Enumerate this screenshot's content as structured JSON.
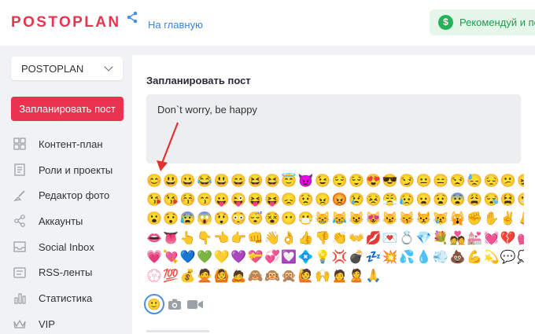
{
  "header": {
    "logo_text": "POSTOPLAN",
    "logo_icon": "share-icon",
    "home_link": "На главную",
    "recommend_label": "Рекомендуй и по",
    "recommend_icon": "dollar-icon",
    "brand_color": "#e8344e",
    "accent_green": "#24b158"
  },
  "sidebar": {
    "project_name": "POSTOPLAN",
    "plan_button": "Запланировать пост",
    "items": [
      {
        "label": "Контент-план",
        "icon": "calendar-grid-icon"
      },
      {
        "label": "Роли и проекты",
        "icon": "document-icon"
      },
      {
        "label": "Редактор фото",
        "icon": "brush-icon"
      },
      {
        "label": "Аккаунты",
        "icon": "share-icon"
      },
      {
        "label": "Social Inbox",
        "icon": "inbox-icon"
      },
      {
        "label": "RSS-ленты",
        "icon": "rss-icon"
      },
      {
        "label": "Статистика",
        "icon": "bar-chart-icon"
      },
      {
        "label": "VIP",
        "icon": "crown-icon"
      }
    ]
  },
  "composer": {
    "title": "Запланировать пост",
    "post_text": "Don`t worry, be happy",
    "emoji_rows": [
      "😊😃😀😂😃😄😆😆😇😈😉😌😌😍😎😏😐😑😒😓😔😕😖",
      "😘😘😚😙😛😜😝😝😞😟😠😡😢😣😤😥😦😧😨😩😪😫😬",
      "😮😯😰😱😲😳😴😵😶😷😸😹😺😻😼😽😾😿🙀✊✋✌👃",
      "👄👅👆👇👈👉👊👋👌👍👎👏👐💋💌💍💎💐💑💒💓💔💕💖",
      "💗💘💙💚💛💜💝💞💟💠💡💢💣💤💥💦💧💨💩💪💫💬💭",
      "💮💯💰🙅🙆🙇🙈🙉🙊🙋🙌🙍🙎🙏"
    ],
    "toolbar": {
      "emoji_button": "smile-icon",
      "photo_button": "camera-icon",
      "video_button": "video-icon"
    },
    "smile_glyph": "🙂"
  }
}
